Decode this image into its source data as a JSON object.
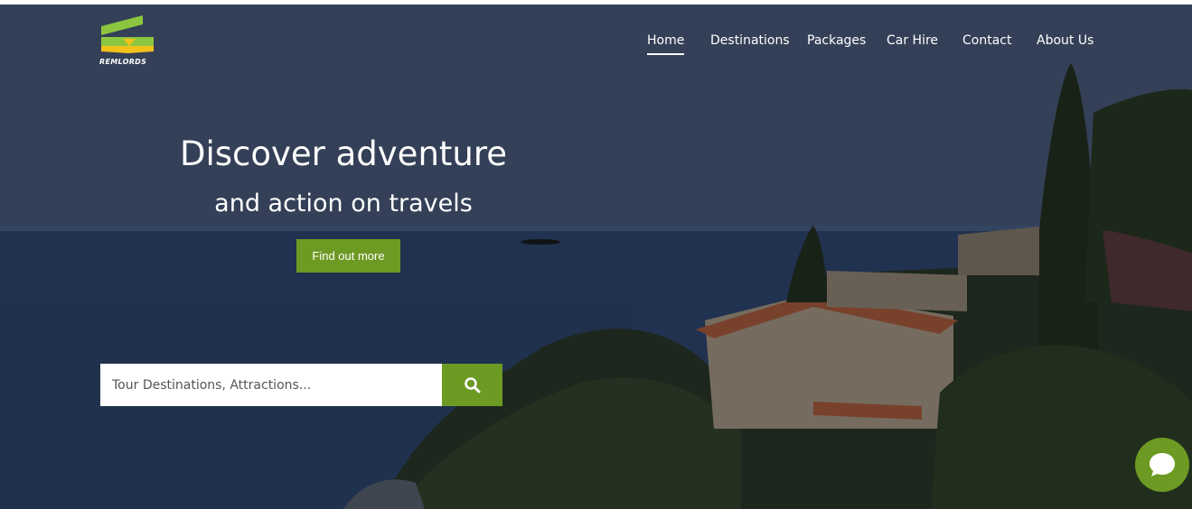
{
  "brand": {
    "logo_text": "REMLORDS",
    "colors": {
      "green": "#6c9a23",
      "yellow": "#f2c21b",
      "lime": "#8cc63f"
    }
  },
  "nav": {
    "items": [
      {
        "label": "Home",
        "active": true
      },
      {
        "label": "Destinations"
      },
      {
        "label": "Packages"
      },
      {
        "label": "Car Hire"
      },
      {
        "label": "Contact"
      },
      {
        "label": "About Us"
      }
    ]
  },
  "hero": {
    "headline": "Discover adventure",
    "subhead": "and action on travels",
    "cta_label": "Find out more"
  },
  "search": {
    "placeholder": "Tour Destinations, Attractions...",
    "button_icon": "search-icon"
  },
  "chat": {
    "icon": "chat-bubble-icon"
  }
}
